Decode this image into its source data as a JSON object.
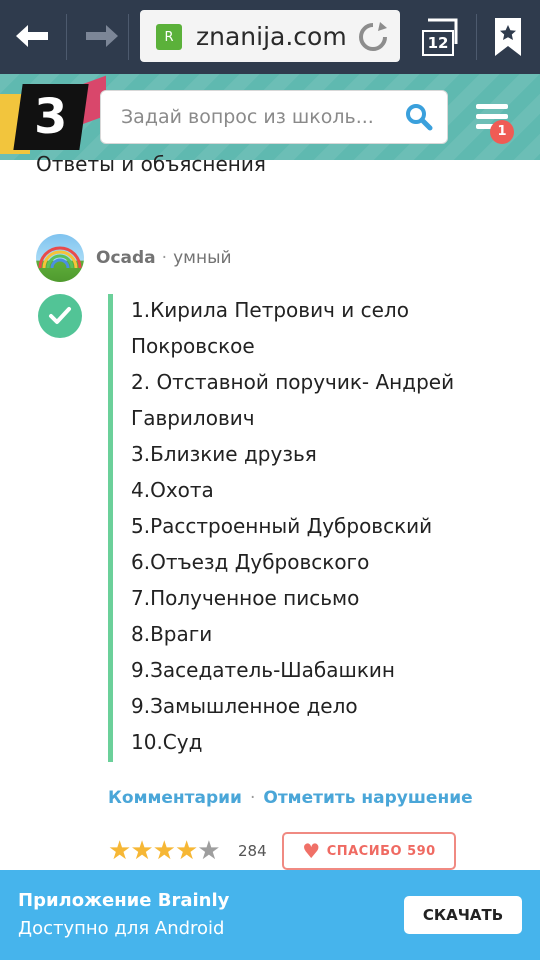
{
  "browser": {
    "url_text": "znanija.com",
    "favicon_letter": "R",
    "tab_count": "12"
  },
  "header": {
    "logo_text": "3",
    "search_placeholder": "Задай вопрос из школь...",
    "menu_badge": "1"
  },
  "content": {
    "section_title": "Ответы и объяснения",
    "author": {
      "name": "Ocada",
      "separator": "·",
      "rank": "умный"
    },
    "answer_lines": [
      "1.Кирила Петрович и село",
      "Покровское",
      "2. Отставной поручик- Андрей",
      "Гаврилович",
      "3.Близкие друзья",
      "4.Охота",
      "5.Расстроенный Дубровский",
      "6.Отъезд  Дубровского",
      "7.Полученное письмо",
      "8.Враги",
      "9.Заседатель-Шабашкин",
      "9.Замышленное дело",
      "10.Суд"
    ],
    "actions": {
      "comments": "Комментарии",
      "separator": "·",
      "report": "Отметить нарушение"
    },
    "rating": {
      "stars_filled": 4,
      "stars_total": 5,
      "count": "284"
    },
    "thanks": {
      "label": "СПАСИБО 590"
    }
  },
  "banner": {
    "title": "Приложение Brainly",
    "subtitle": "Доступно для Android",
    "button": "СКАЧАТЬ"
  },
  "colors": {
    "browser_bar": "#2f3b4d",
    "accent_green": "#52c496",
    "link_blue": "#4aa6d8",
    "banner_blue": "#46b4ec",
    "star_gold": "#f6b735",
    "thanks_red": "#ef6a62"
  }
}
